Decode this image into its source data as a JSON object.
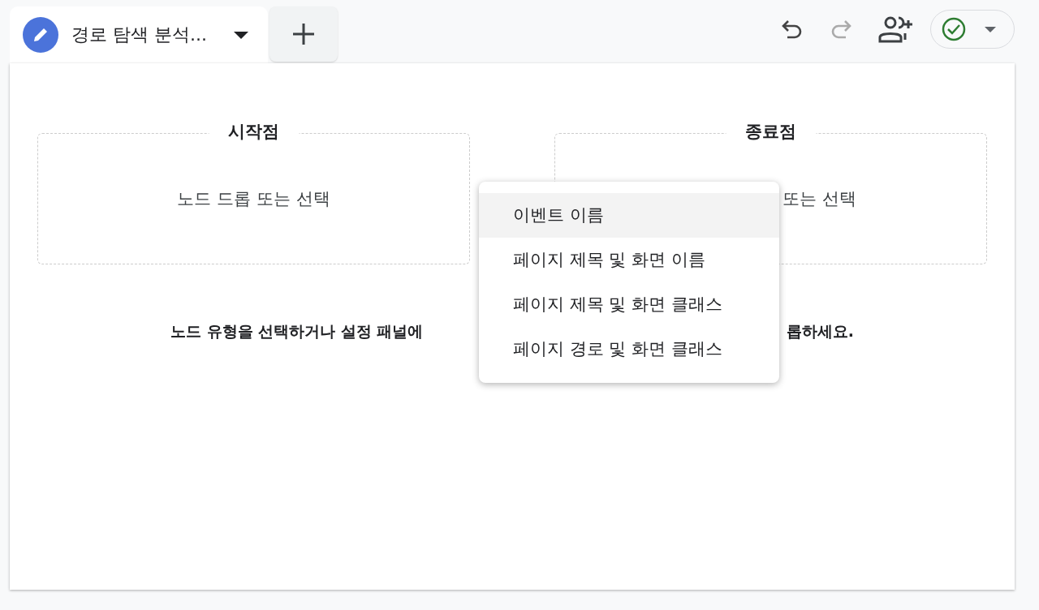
{
  "tabs": [
    {
      "title": "경로 탐색 분석...",
      "selected": true
    }
  ],
  "toolbar": {
    "undo": {
      "disabled": false
    },
    "redo": {
      "disabled": true
    }
  },
  "nodes": [
    {
      "kind": "start",
      "title": "시작점",
      "placeholder": "노드 드롭 또는 선택"
    },
    {
      "kind": "end",
      "title": "종료점",
      "placeholder": "또는 선택"
    }
  ],
  "hint": {
    "left": "노드 유형을 선택하거나 설정 패널에",
    "right": "롭하세요."
  },
  "menu": [
    {
      "label": "이벤트 이름",
      "selected": true
    },
    {
      "label": "페이지 제목 및 화면 이름",
      "selected": false
    },
    {
      "label": "페이지 제목 및 화면 클래스",
      "selected": false
    },
    {
      "label": "페이지 경로 및 화면 클래스",
      "selected": false
    }
  ]
}
